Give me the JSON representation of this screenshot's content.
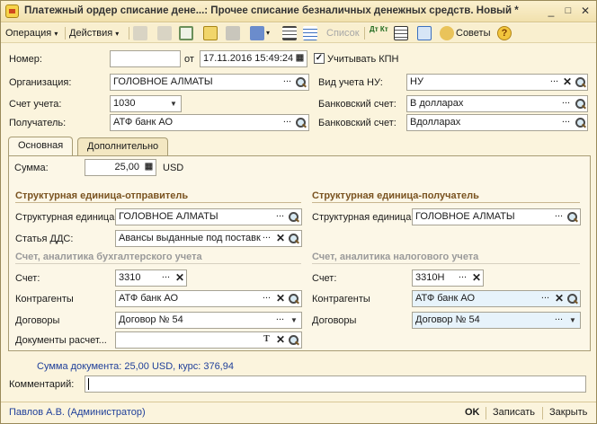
{
  "window": {
    "title": "Платежный ордер списание дене...: Прочее списание безналичных денежных средств. Новый *",
    "minimize": "_",
    "maximize": "□",
    "close": "✕"
  },
  "toolbar": {
    "operation": "Операция",
    "actions": "Действия",
    "list": "Список",
    "dtkt": "Дт Кт",
    "advice": "Советы",
    "help": "?"
  },
  "header": {
    "number_label": "Номер:",
    "number_value": "",
    "from_label": "от",
    "date_value": "17.11.2016 15:49:24",
    "kpn_label": "Учитывать КПН",
    "kpn_checked": "✓",
    "org_label": "Организация:",
    "org_value": "ГОЛОВНОЕ АЛМАТЫ",
    "nu_label": "Вид учета НУ:",
    "nu_value": "НУ",
    "account_label": "Счет учета:",
    "account_value": "1030",
    "bank_account_label": "Банковский счет:",
    "bank_account_value": "В долларах",
    "recipient_label": "Получатель:",
    "recipient_value": "АТФ банк АО",
    "bank_account2_label": "Банковский счет:",
    "bank_account2_value": "Вдолларах"
  },
  "tabs": [
    {
      "label": "Основная"
    },
    {
      "label": "Дополнительно"
    }
  ],
  "main": {
    "sum_label": "Сумма:",
    "sum_value": "25,00",
    "currency": "USD",
    "sender_section": "Структурная единица-отправитель",
    "receiver_section": "Структурная единица-получатель",
    "sender_unit_label": "Структурная единица:",
    "sender_unit_value": "ГОЛОВНОЕ АЛМАТЫ",
    "receiver_unit_label": "Структурная единица:",
    "receiver_unit_value": "ГОЛОВНОЕ АЛМАТЫ",
    "dds_label": "Статья ДДС:",
    "dds_value": "Авансы выданные под поставк",
    "acc_section": "Счет, аналитика бухгалтерского учета",
    "tax_section": "Счет, аналитика налогового учета",
    "acc_label": "Счет:",
    "acc_value": "3310",
    "tax_acc_label": "Счет:",
    "tax_acc_value": "3310Н",
    "counterparty_label": "Контрагенты",
    "counterparty_value": "АТФ банк АО",
    "tax_counterparty_label": "Контрагенты",
    "tax_counterparty_value": "АТФ банк АО",
    "contracts_label": "Договоры",
    "contracts_value": "Договор № 54",
    "tax_contracts_label": "Договоры",
    "tax_contracts_value": "Договор № 54",
    "settlement_docs_label": "Документы расчет...",
    "settlement_docs_value": ""
  },
  "footer": {
    "doc_sum": "Сумма документа: 25,00 USD, курс: 376,94",
    "comment_label": "Комментарий:",
    "comment_value": "",
    "user": "Павлов А.В. (Администратор)",
    "ok": "OK",
    "save": "Записать",
    "close": "Закрыть"
  },
  "colors": {
    "window_bg": "#fbf4dd",
    "section_title": "#7a5320",
    "link": "#1f3f9a"
  }
}
